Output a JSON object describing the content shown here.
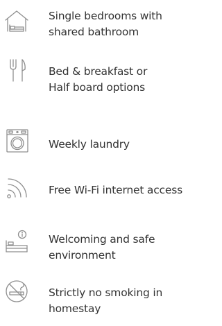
{
  "amenities": [
    {
      "icon": "house-bed-icon",
      "line1": "Single bedrooms with",
      "line2": "shared bathroom"
    },
    {
      "icon": "fork-knife-icon",
      "line1": "Bed & breakfast or",
      "line2": "Half board options"
    },
    {
      "icon": "washing-machine-icon",
      "line1": "Weekly laundry",
      "line2": ""
    },
    {
      "icon": "wifi-icon",
      "line1": "Free Wi-Fi internet access",
      "line2": ""
    },
    {
      "icon": "bed-info-icon",
      "line1": "Welcoming and safe",
      "line2": "environment"
    },
    {
      "icon": "no-smoking-icon",
      "line1": "Strictly no smoking in",
      "line2": "homestay"
    }
  ]
}
